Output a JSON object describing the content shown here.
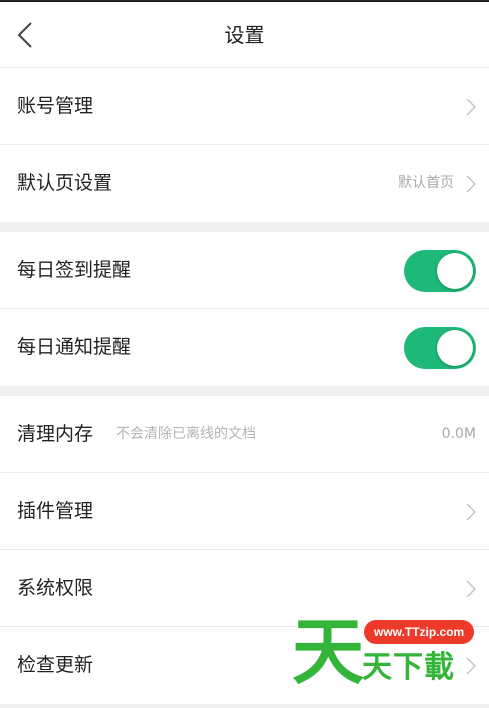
{
  "header": {
    "title": "设置",
    "back_icon": "chevron-left-icon"
  },
  "groups": [
    {
      "items": [
        {
          "label": "账号管理",
          "value": "",
          "control": "chevron"
        },
        {
          "label": "默认页设置",
          "value": "默认首页",
          "control": "chevron"
        }
      ]
    },
    {
      "items": [
        {
          "label": "每日签到提醒",
          "control": "toggle",
          "on": true
        },
        {
          "label": "每日通知提醒",
          "control": "toggle",
          "on": true
        }
      ]
    },
    {
      "items": [
        {
          "label": "清理内存",
          "sublabel": "不会清除已离线的文档",
          "value": "0.0M",
          "control": "none"
        },
        {
          "label": "插件管理",
          "control": "chevron"
        },
        {
          "label": "系统权限",
          "control": "chevron"
        },
        {
          "label": "检查更新",
          "control": "chevron"
        }
      ]
    }
  ],
  "watermark": {
    "big": "天",
    "url": "www.TTzip.com",
    "text": "天下載"
  },
  "colors": {
    "toggle_on": "#1eb877",
    "background": "#efefef",
    "watermark_green": "#34b53a",
    "watermark_red": "#ee3a2a"
  }
}
